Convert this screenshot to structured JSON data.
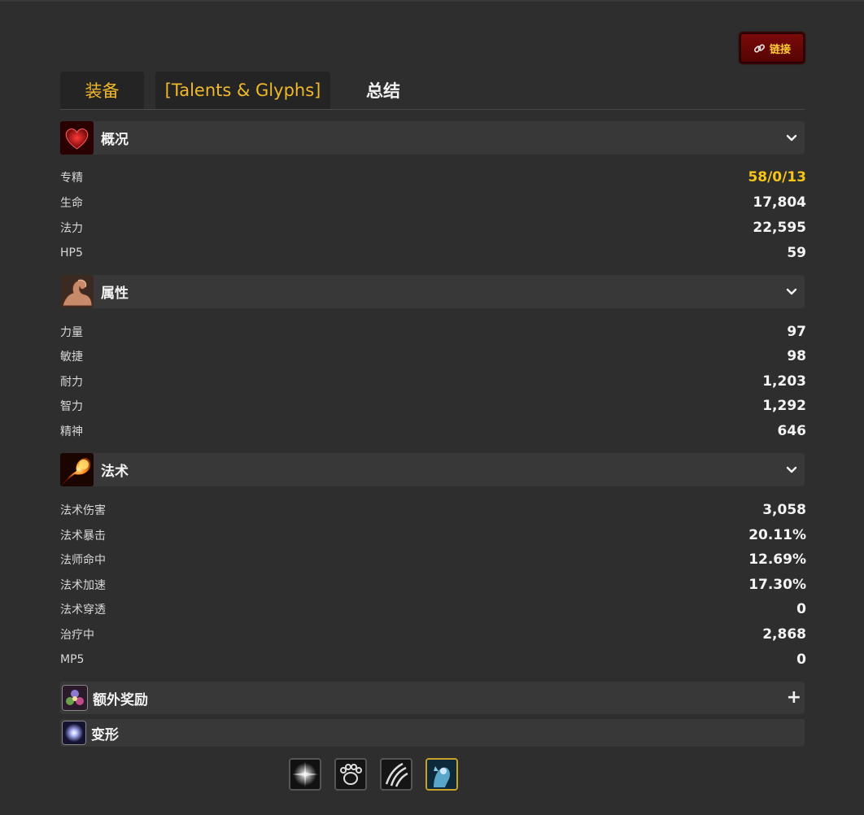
{
  "link_button": {
    "label": "链接"
  },
  "tabs": [
    {
      "label": "装备"
    },
    {
      "label": "[Talents & Glyphs]"
    },
    {
      "label": "总结"
    }
  ],
  "sections": {
    "overview": {
      "title": "概况",
      "icon": "heart-icon",
      "rows": [
        {
          "label": "专精",
          "value": "58/0/13"
        },
        {
          "label": "生命",
          "value": "17,804"
        },
        {
          "label": "法力",
          "value": "22,595"
        },
        {
          "label": "HP5",
          "value": "59"
        }
      ]
    },
    "attributes": {
      "title": "属性",
      "icon": "bicep-icon",
      "rows": [
        {
          "label": "力量",
          "value": "97"
        },
        {
          "label": "敏捷",
          "value": "98"
        },
        {
          "label": "耐力",
          "value": "1,203"
        },
        {
          "label": "智力",
          "value": "1,292"
        },
        {
          "label": "精神",
          "value": "646"
        }
      ]
    },
    "spells": {
      "title": "法术",
      "icon": "fireball-icon",
      "rows": [
        {
          "label": "法术伤害",
          "value": "3,058"
        },
        {
          "label": "法术暴击",
          "value": "20.11%"
        },
        {
          "label": "法师命中",
          "value": "12.69%"
        },
        {
          "label": "法术加速",
          "value": "17.30%"
        },
        {
          "label": "法术穿透",
          "value": "0"
        },
        {
          "label": "治疗中",
          "value": "2,868"
        },
        {
          "label": "MP5",
          "value": "0"
        }
      ]
    },
    "bonus": {
      "title": "额外奖励",
      "icon": "set-bonus-icon"
    },
    "shapeshift": {
      "title": "变形",
      "icon": "moonkin-glow-icon"
    }
  },
  "specs": [
    {
      "icon": "starburst-icon",
      "active": false
    },
    {
      "icon": "bear-paw-icon",
      "active": false
    },
    {
      "icon": "claw-slash-icon",
      "active": false
    },
    {
      "icon": "moonkin-form-icon",
      "active": true
    }
  ],
  "colors": {
    "background": "#2e2e2e",
    "section": "#383838",
    "gold": "#f5c518",
    "tab_gold": "#f0b82a",
    "link_red": "#6a0606"
  }
}
